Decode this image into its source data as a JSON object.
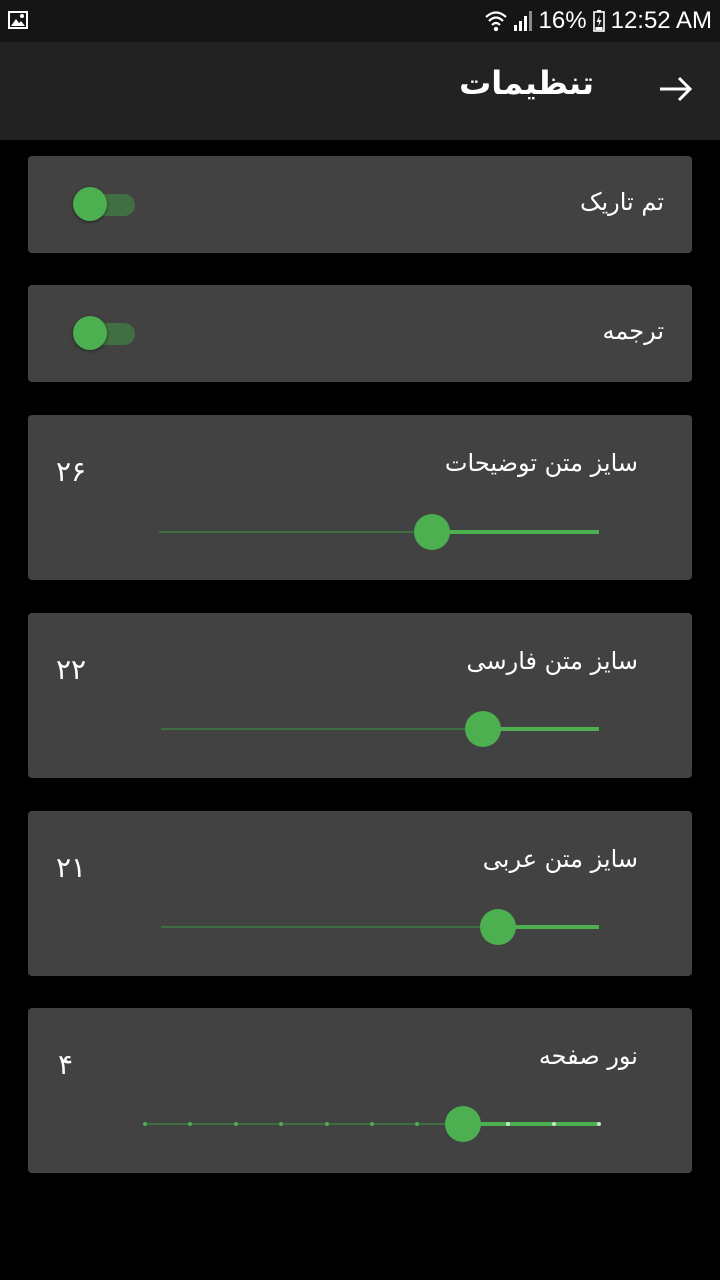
{
  "status_bar": {
    "battery": "16%",
    "time": "12:52 AM",
    "icons": [
      "gallery-icon",
      "wifi-icon",
      "signal-icon",
      "battery-icon"
    ]
  },
  "app_bar": {
    "title": "تنظیمات",
    "back_icon": "arrow-right-icon"
  },
  "settings": {
    "dark_theme": {
      "label": "تم تاریک",
      "on": true
    },
    "translation": {
      "label": "ترجمه",
      "on": true
    },
    "description_size": {
      "label": "سایز متن توضیحات",
      "value": "۲۶",
      "fraction": 0.38
    },
    "persian_size": {
      "label": "سایز متن فارسی",
      "value": "۲۲",
      "fraction": 0.265
    },
    "arabic_size": {
      "label": "سایز متن عربی",
      "value": "۲۱",
      "fraction": 0.23
    },
    "brightness": {
      "label": "نور صفحه",
      "value": "۴",
      "fraction": 0.3,
      "ticks": 10
    }
  },
  "colors": {
    "accent": "#4caf50",
    "card": "#424242",
    "app_bar": "#222222",
    "background": "#000000"
  }
}
